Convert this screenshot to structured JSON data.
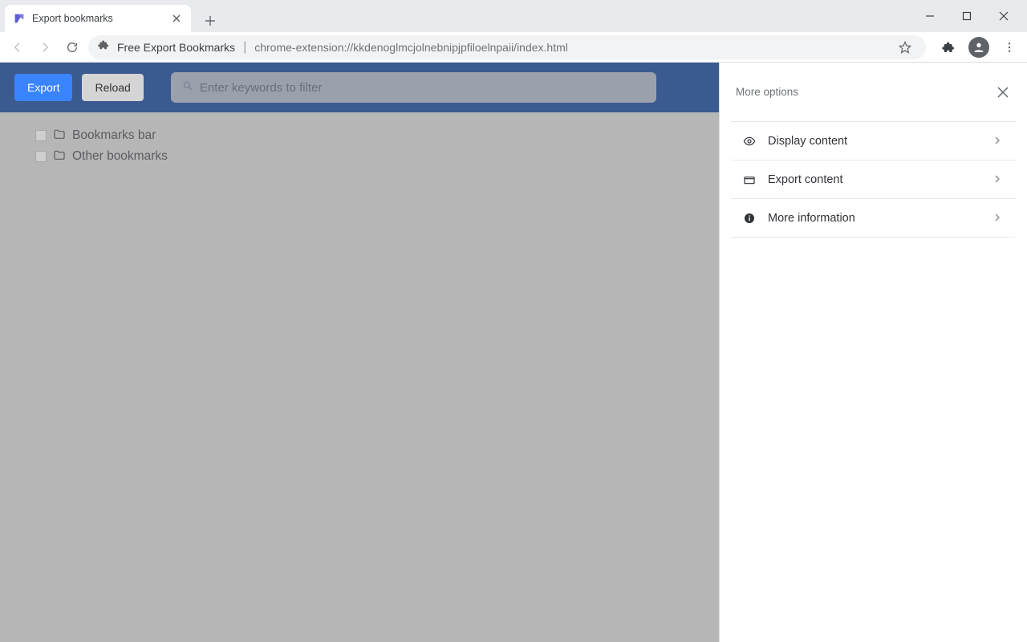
{
  "browser": {
    "tab_title": "Export bookmarks",
    "omnibox_primary": "Free Export Bookmarks",
    "omnibox_secondary": "chrome-extension://kkdenoglmcjolnebnipjpfiloelnpaii/index.html"
  },
  "page": {
    "export_label": "Export",
    "reload_label": "Reload",
    "filter_placeholder": "Enter keywords to filter",
    "tree": [
      {
        "label": "Bookmarks bar"
      },
      {
        "label": "Other bookmarks"
      }
    ]
  },
  "sidepanel": {
    "title": "More options",
    "items": [
      {
        "icon": "eye",
        "label": "Display content"
      },
      {
        "icon": "export",
        "label": "Export content"
      },
      {
        "icon": "info",
        "label": "More information"
      }
    ]
  }
}
